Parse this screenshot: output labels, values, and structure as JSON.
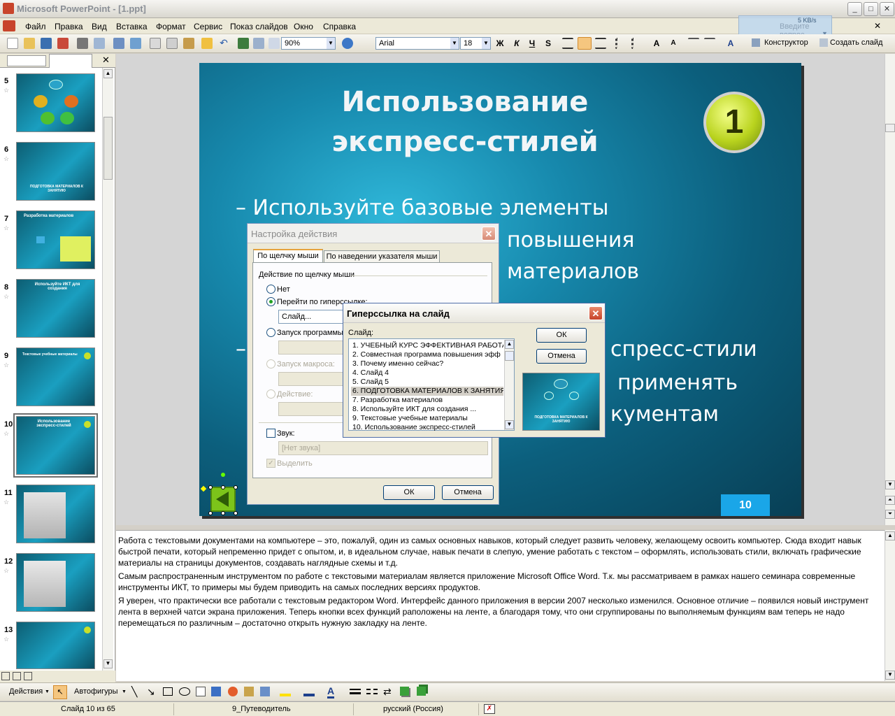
{
  "window": {
    "title": "Microsoft PowerPoint - [1.ppt]"
  },
  "menu": [
    "Файл",
    "Правка",
    "Вид",
    "Вставка",
    "Формат",
    "Сервис",
    "Показ слайдов",
    "Окно",
    "Справка"
  ],
  "toolbar": {
    "zoom": "90%",
    "font": "Arial",
    "font_size": "18",
    "bold": "Ж",
    "italic": "К",
    "underline": "Ч",
    "shadow": "S",
    "designer": "Конструктор",
    "new_slide": "Создать слайд"
  },
  "help": {
    "speed": "5 KB/s",
    "placeholder": "Введите вопрос"
  },
  "thumbnails": [
    {
      "num": "5",
      "title": ""
    },
    {
      "num": "6",
      "title": "ПОДГОТОВКА МАТЕРИАЛОВ К ЗАНЯТИЮ"
    },
    {
      "num": "7",
      "title": "Разработка материалов"
    },
    {
      "num": "8",
      "title": "Используйте ИКТ для создания"
    },
    {
      "num": "9",
      "title": "Текстовые учебные материалы"
    },
    {
      "num": "10",
      "title": "Использование экспресс-стилей"
    },
    {
      "num": "11",
      "title": ""
    },
    {
      "num": "12",
      "title": ""
    },
    {
      "num": "13",
      "title": ""
    }
  ],
  "slide": {
    "title_line1": "Использование",
    "title_line2": "экспресс-стилей",
    "badge": "1",
    "page_number": "10",
    "bullet1_l1": "– Используйте базовые элементы",
    "bullet1_l2": "повышения",
    "bullet1_l3": "материалов",
    "bullet2_l1": "спресс-стили",
    "bullet2_l2": "применять",
    "bullet2_l3": "кументам",
    "bullet2_dash": "–"
  },
  "action_dialog": {
    "title": "Настройка действия",
    "tab_click": "По щелчку мыши",
    "tab_hover": "По наведении указателя мыши",
    "group": "Действие по щелчку мыши",
    "opt_none": "Нет",
    "opt_hyperlink": "Перейти по гиперссылке:",
    "hyperlink_value": "Слайд...",
    "opt_program": "Запуск программы",
    "opt_macro": "Запуск макроса:",
    "opt_action": "Действие:",
    "sound": "Звук:",
    "sound_value": "[Нет звука]",
    "highlight": "Выделить",
    "ok": "ОК",
    "cancel": "Отмена"
  },
  "hyperlink_dialog": {
    "title": "Гиперссылка на слайд",
    "label": "Слайд:",
    "items": [
      "1. УЧЕБНЫЙ КУРС ЭФФЕКТИВНАЯ РАБОТА",
      "2. Совместная программа  повышения эфф",
      "3. Почему именно сейчас?",
      "4. Слайд 4",
      "5. Слайд 5",
      "6. ПОДГОТОВКА МАТЕРИАЛОВ К ЗАНЯТИЯ",
      "7. Разработка материалов",
      "8. Используйте ИКТ для создания ...",
      "9. Текстовые учебные материалы",
      "10. Использование  экспресс-стилей"
    ],
    "selected_index": 5,
    "preview_caption": "ПОДГОТОВКА МАТЕРИАЛОВ К ЗАНЯТИЮ",
    "ok": "ОК",
    "cancel": "Отмена"
  },
  "notes": [
    "Работа с текстовыми документами на компьютере – это, пожалуй, один из самых основных навыков, который следует развить человеку, желающему освоить компьютер. Сюда входит навык быстрой печати, который непременно придет с опытом, и, в идеальном случае, навык печати в слепую, умение работать с текстом – оформлять, использовать стили, включать графические материалы на страницы документов, создавать наглядные схемы и т.д.",
    "Самым распространенным инструментом по работе с текстовыми материалам является приложение Microsoft Office Word. Т.к. мы рассматриваем в рамках нашего семинара современные инструменты ИКТ, то примеры мы будем приводить на самых последних версиях продуктов.",
    "Я уверен, что практически все работали с текстовым редактором Word. Интерфейс данного приложения в версии 2007 несколько изменился. Основное отличие – появился новый инструмент лента в верхней чатси экрана приложения. Теперь кнопки всех функций раположены на ленте, а благодаря тому, что они сгруппированы по выполняемым функциям вам теперь не надо перемещаться по различным – достаточно открыть нужную закладку на ленте."
  ],
  "drawing": {
    "actions": "Действия",
    "autoshapes": "Автофигуры"
  },
  "status": {
    "slide": "Слайд 10 из 65",
    "design": "9_Путеводитель",
    "lang": "русский (Россия)"
  }
}
